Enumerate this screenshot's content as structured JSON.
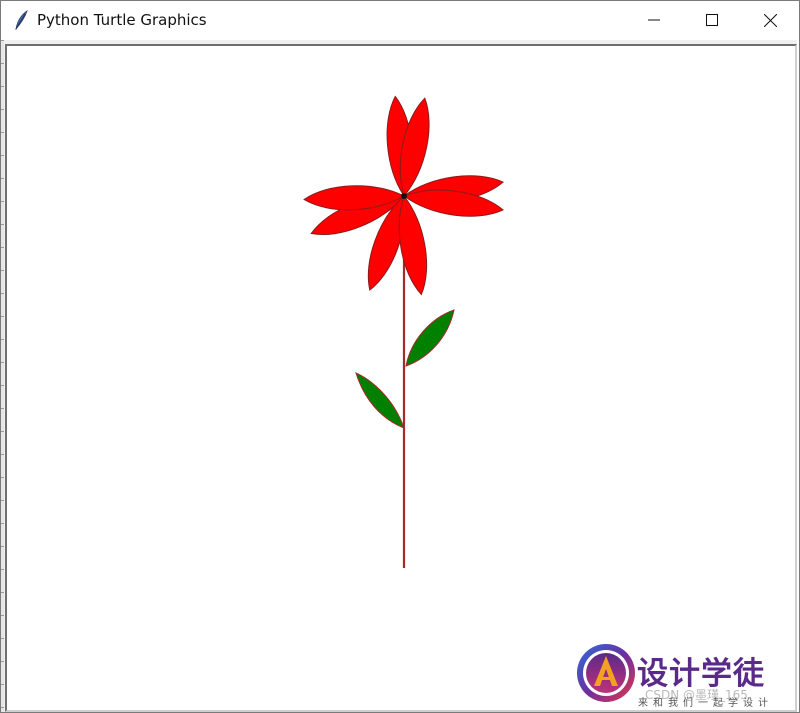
{
  "window": {
    "title": "Python Turtle Graphics",
    "icon": "feather-icon",
    "controls": [
      "minimize-icon",
      "maximize-icon",
      "close-icon"
    ]
  },
  "canvas": {
    "background": "#ffffff",
    "drawing": {
      "stem_color": "#a52a2a",
      "petal_fill": "#ff0000",
      "petal_outline": "#8b1a1a",
      "leaf_fill": "#008000",
      "leaf_outline": "#a52a2a",
      "petal_count": 8,
      "leaf_count": 2
    }
  },
  "watermark": {
    "title": "设计学徒",
    "credit": "CSDN @墨瑾_165",
    "slogan": "来和我们一起学设计",
    "brand_colors": [
      "#5a2a8a",
      "#e63946",
      "#f4a021",
      "#2a6fdb"
    ]
  }
}
